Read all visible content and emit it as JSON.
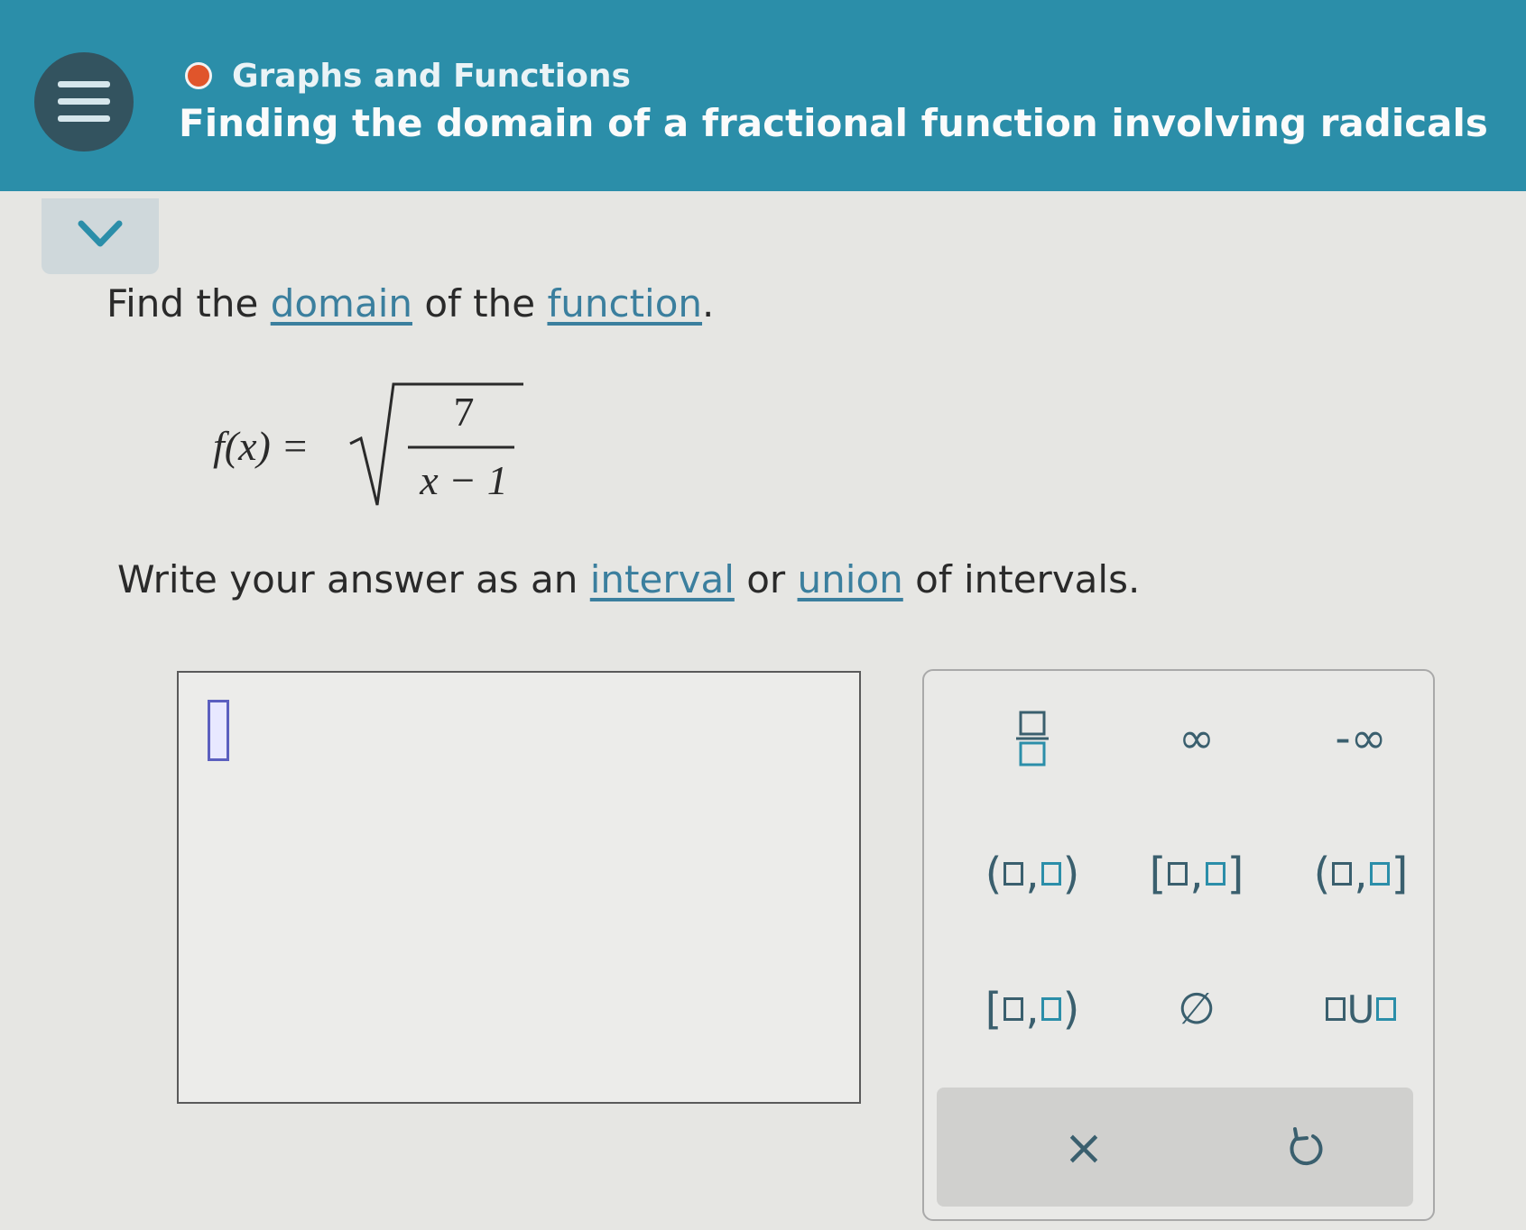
{
  "header": {
    "topic": "Graphs and Functions",
    "title": "Finding the domain of a fractional function involving radicals"
  },
  "question": {
    "prompt_before": "Find the ",
    "link_domain": "domain",
    "prompt_middle": " of the ",
    "link_function": "function",
    "prompt_end": ".",
    "equation": {
      "lhs": "f(x) =",
      "numerator": "7",
      "denominator": "x − 1"
    },
    "instruction_before": "Write your answer as an ",
    "link_interval": "interval",
    "instruction_middle": " or ",
    "link_union": "union",
    "instruction_end": " of intervals."
  },
  "answer": {
    "value": ""
  },
  "keypad": {
    "infinity": "∞",
    "neg_infinity": "-∞",
    "empty_set": "∅",
    "open_open_left": "(",
    "open_open_right": ")",
    "closed_closed_left": "[",
    "closed_closed_right": "]",
    "comma": ",",
    "union": "U"
  },
  "actions": {
    "clear": "×"
  },
  "colors": {
    "header": "#2b8ea9",
    "topic_dot": "#e0552b",
    "link": "#3b7f9e"
  }
}
